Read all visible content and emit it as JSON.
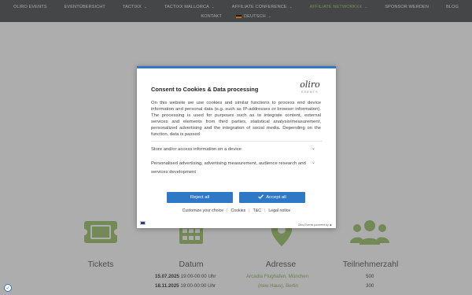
{
  "nav": {
    "row1": [
      {
        "label": "OLIRO EVENTS",
        "caret": false,
        "active": false
      },
      {
        "label": "EVENTÜBERSICHT",
        "caret": false,
        "active": false
      },
      {
        "label": "TACTIXX",
        "caret": true,
        "active": false
      },
      {
        "label": "TACTIXX MALLORCA",
        "caret": true,
        "active": false
      },
      {
        "label": "AFFILIATE CONFERENCE",
        "caret": true,
        "active": false
      },
      {
        "label": "AFFILIATE NETWORKXX",
        "caret": true,
        "active": true
      },
      {
        "label": "SPONSOR WERDEN",
        "caret": false,
        "active": false
      },
      {
        "label": "BLOG",
        "caret": false,
        "active": false
      }
    ],
    "kontakt": "KONTAKT",
    "language": "DEUTSCH"
  },
  "caret_glyph": "⌄",
  "dialog": {
    "title": "Consent to Cookies & Data processing",
    "logo_text": "oliro",
    "logo_sub": "EVENTS",
    "body": "On this website we use cookies and similar functions to process end device information and personal data (e.g. such as IP-addresses or browser information). The processing is used for purposes such as to integrate content, external services and elements from third parties, statistical analysis/measurement, personalized advertising and the integration of social media. Depending on the function, data is passed",
    "purpose1": "Store and/or access information on a device",
    "purpose2": "Personalised advertising, advertising measurement, audience research and services development",
    "reject_label": "Reject all",
    "accept_label": "Accept all",
    "links": [
      "Customize your choice",
      "Cookies",
      "T&C",
      "Legal notice"
    ],
    "powered_by": "Oliro Events powered by"
  },
  "page": {
    "headings": [
      "Tickets",
      "Datum",
      "Adresse",
      "Teilnehmerzahl"
    ],
    "rows": [
      {
        "date": "15.07.2025",
        "time": "19:00-00:00 Uhr",
        "address": "Arcadia Flughafen, München",
        "participants": "500"
      },
      {
        "date": "18.11.2025",
        "time": "19:00-00:00 Uhr",
        "address": "(new Haus), Berlin",
        "participants": "300"
      }
    ]
  },
  "colors": {
    "nav_bg": "#4a4e52",
    "active_nav": "#a6c46a",
    "button_blue": "#2f78c6",
    "icon_green": "#9bc36a"
  }
}
